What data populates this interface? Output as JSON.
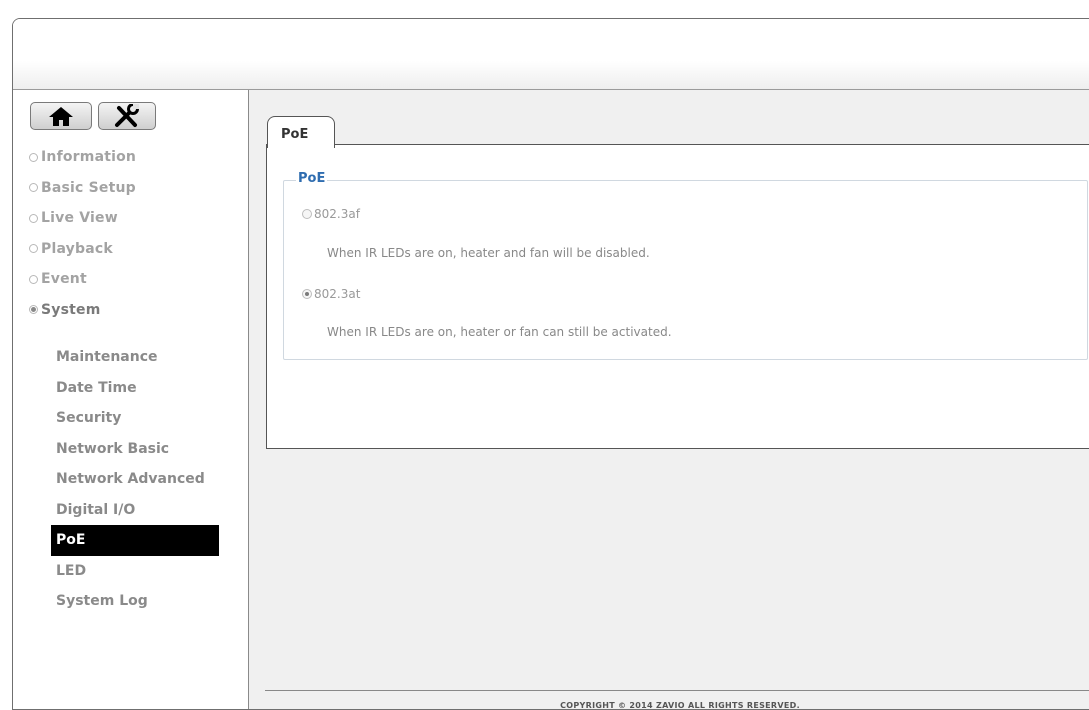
{
  "toolbar": {
    "home_icon": "home-icon",
    "settings_icon": "tools-icon"
  },
  "sidebar": {
    "menu": [
      {
        "label": "Information",
        "selected": false
      },
      {
        "label": "Basic Setup",
        "selected": false
      },
      {
        "label": "Live View",
        "selected": false
      },
      {
        "label": "Playback",
        "selected": false
      },
      {
        "label": "Event",
        "selected": false
      },
      {
        "label": "System",
        "selected": true
      }
    ],
    "system_items": [
      {
        "label": "Maintenance"
      },
      {
        "label": "Date Time"
      },
      {
        "label": "Security"
      },
      {
        "label": "Network Basic"
      },
      {
        "label": "Network Advanced"
      },
      {
        "label": "Digital I/O"
      },
      {
        "label": "PoE",
        "selected": true
      },
      {
        "label": "LED"
      },
      {
        "label": "System Log"
      }
    ]
  },
  "main": {
    "tab_label": "PoE",
    "group_title": "PoE",
    "options": [
      {
        "label": "802.3af",
        "checked": false,
        "description": "When IR LEDs are on, heater and fan will be disabled."
      },
      {
        "label": "802.3at",
        "checked": true,
        "description": "When IR LEDs are on, heater or fan can still be activated."
      }
    ]
  },
  "footer": {
    "copyright": "COPYRIGHT © 2014 ZAVIO ALL RIGHTS RESERVED."
  },
  "colors": {
    "legend_blue": "#2f6db0",
    "selected_bg": "#000000",
    "content_bg": "#f0f0f0"
  }
}
